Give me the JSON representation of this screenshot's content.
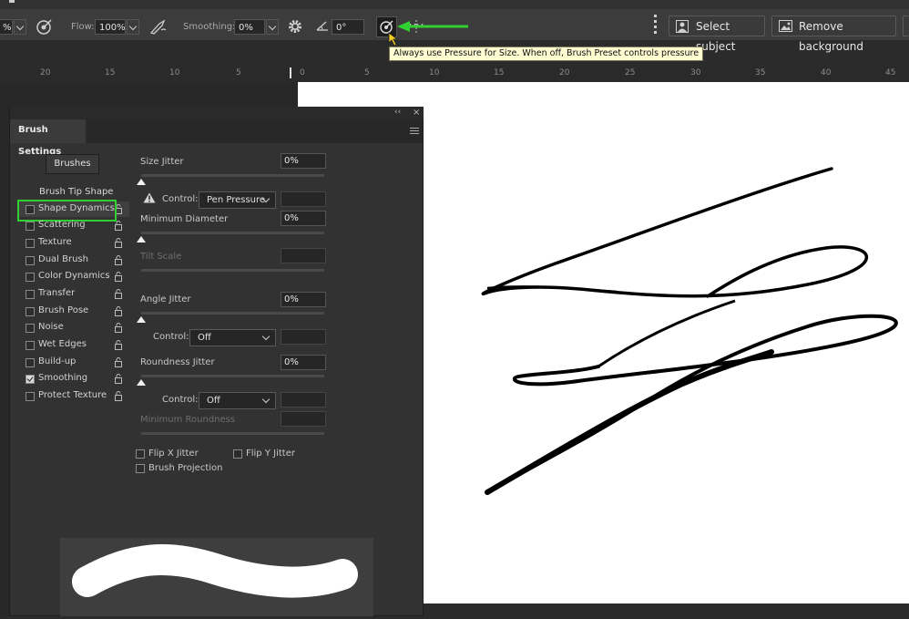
{
  "options_bar": {
    "opacity_value": "%",
    "flow_label": "Flow:",
    "flow_value": "100%",
    "smoothing_label": "Smoothing:",
    "smoothing_value": "0%",
    "angle_value": "0°",
    "select_subject_label": "Select subject",
    "remove_background_label": "Remove background"
  },
  "tooltip": "Always use Pressure for Size. When off, Brush Preset controls pressure",
  "ruler_left": [
    "20",
    "15",
    "10",
    "5"
  ],
  "ruler_right": [
    "0",
    "5",
    "10",
    "15",
    "20",
    "25",
    "30",
    "35",
    "40",
    "45"
  ],
  "panel": {
    "title": "Brush Settings",
    "brushes_button": "Brushes",
    "brush_tip_shape": "Brush Tip Shape",
    "categories": [
      {
        "label": "Shape Dynamics",
        "checked": false
      },
      {
        "label": "Scattering",
        "checked": false
      },
      {
        "label": "Texture",
        "checked": false
      },
      {
        "label": "Dual Brush",
        "checked": false
      },
      {
        "label": "Color Dynamics",
        "checked": false
      },
      {
        "label": "Transfer",
        "checked": false
      },
      {
        "label": "Brush Pose",
        "checked": false
      },
      {
        "label": "Noise",
        "checked": false
      },
      {
        "label": "Wet Edges",
        "checked": false
      },
      {
        "label": "Build-up",
        "checked": false
      },
      {
        "label": "Smoothing",
        "checked": true
      },
      {
        "label": "Protect Texture",
        "checked": false
      }
    ],
    "size_jitter": {
      "label": "Size Jitter",
      "value": "0%"
    },
    "size_control": {
      "label": "Control:",
      "value": "Pen Pressure"
    },
    "minimum_diameter": {
      "label": "Minimum Diameter",
      "value": "0%"
    },
    "tilt_scale": {
      "label": "Tilt Scale"
    },
    "angle_jitter": {
      "label": "Angle Jitter",
      "value": "0%"
    },
    "angle_control": {
      "label": "Control:",
      "value": "Off"
    },
    "roundness_jitter": {
      "label": "Roundness Jitter",
      "value": "0%"
    },
    "roundness_control": {
      "label": "Control:",
      "value": "Off"
    },
    "minimum_roundness": {
      "label": "Minimum Roundness"
    },
    "flip_x": "Flip X Jitter",
    "flip_y": "Flip Y Jitter",
    "brush_projection": "Brush Projection"
  },
  "colors": {
    "highlight_green": "#2fd02f",
    "canvas": "#ffffff",
    "panel_bg": "#323232"
  }
}
